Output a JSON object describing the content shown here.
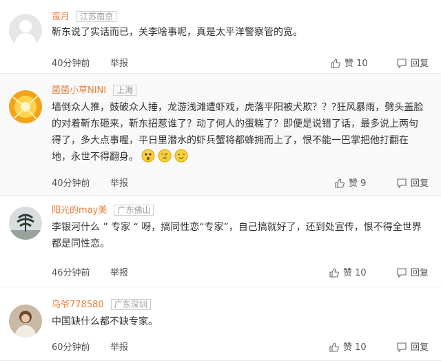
{
  "comments": [
    {
      "user": "蛮月",
      "location": "江苏南京",
      "text": "靳东说了实话而已，关李啥事呢，真是太平洋警察管的宽。",
      "time": "40分钟前",
      "report": "举报",
      "likes": "赞 10",
      "reply": "回复"
    },
    {
      "user": "菌菌小草NINI",
      "location": "上海",
      "text": "墙倒众人推，鼓破众人捶，龙游浅滩遭虾戏，虎落平阳被犬欺？？?狂风暴雨，劈头盖脸的对着靳东砸来，靳东招惹谁了？动了何人的蛋糕了？即便是说错了话，最多说上两句得了，多大点事喔，平日里潜水的虾兵蟹将都蜂拥而上了，恨不能一巴掌把他打翻在地，永世不得翻身。",
      "time": "40分钟前",
      "report": "举报",
      "likes": "赞 9",
      "reply": "回复"
    },
    {
      "user": "阳光的may美",
      "location": "广东佛山",
      "text": "李银河什么 ” 专家 “ 呀，搞同性恋“专家”，自己搞就好了，还到处宣传，恨不得全世界都是同性恋。",
      "time": "46分钟前",
      "report": "举报",
      "likes": "赞 10",
      "reply": "回复"
    },
    {
      "user": "鸟爷778580",
      "location": "广东深圳",
      "text": "中国缺什么都不缺专家。",
      "time": "60分钟前",
      "report": "举报",
      "likes": "赞 10",
      "reply": "回复"
    }
  ],
  "colors": {
    "username": "#e8803d",
    "location": "#999999",
    "text": "#333333",
    "divider": "#e8e8e8"
  },
  "icons": {
    "like": "thumbs-up-icon",
    "reply": "chat-bubble-icon",
    "emoticons": [
      "surprised-face-icon",
      "thinking-face-icon",
      "smirk-face-icon"
    ]
  }
}
